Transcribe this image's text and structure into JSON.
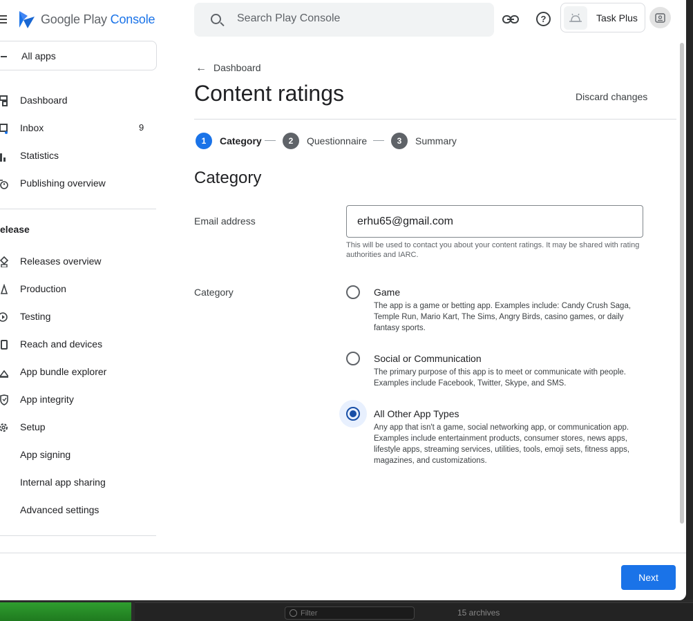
{
  "header": {
    "logo_google": "Google Play ",
    "logo_console": "Console",
    "search_placeholder": "Search Play Console",
    "app_name": "Task Plus"
  },
  "sidebar": {
    "all_apps": "All apps",
    "items_top": [
      {
        "label": "Dashboard",
        "icon": "dashboard-icon"
      },
      {
        "label": "Inbox",
        "icon": "inbox-icon",
        "count": "9"
      },
      {
        "label": "Statistics",
        "icon": "statistics-icon"
      },
      {
        "label": "Publishing overview",
        "icon": "publishing-icon"
      }
    ],
    "section_release": "elease",
    "items_release": [
      {
        "label": "Releases overview",
        "icon": "releases-icon"
      },
      {
        "label": "Production",
        "icon": "production-icon"
      },
      {
        "label": "Testing",
        "icon": "testing-icon"
      },
      {
        "label": "Reach and devices",
        "icon": "devices-icon"
      },
      {
        "label": "App bundle explorer",
        "icon": "bundle-icon"
      },
      {
        "label": "App integrity",
        "icon": "shield-icon"
      },
      {
        "label": "Setup",
        "icon": "gear-icon"
      },
      {
        "label": "App signing"
      },
      {
        "label": "Internal app sharing"
      },
      {
        "label": "Advanced settings"
      }
    ]
  },
  "main": {
    "back_label": "Dashboard",
    "title": "Content ratings",
    "discard": "Discard changes",
    "steps": [
      {
        "num": "1",
        "label": "Category"
      },
      {
        "num": "2",
        "label": "Questionnaire"
      },
      {
        "num": "3",
        "label": "Summary"
      }
    ],
    "section_heading": "Category",
    "email_label": "Email address",
    "email_value": "erhu65@gmail.com",
    "email_help": "This will be used to contact you about your content ratings. It may be shared with rating authorities and IARC.",
    "category_label": "Category",
    "options": [
      {
        "title": "Game",
        "desc": "The app is a game or betting app. Examples include: Candy Crush Saga, Temple Run, Mario Kart, The Sims, Angry Birds, casino games, or daily fantasy sports.",
        "selected": false
      },
      {
        "title": "Social or Communication",
        "desc": "The primary purpose of this app is to meet or communicate with people. Examples include Facebook, Twitter, Skype, and SMS.",
        "selected": false
      },
      {
        "title": "All Other App Types",
        "desc": "Any app that isn't a game, social networking app, or communication app. Examples include entertainment products, consumer stores, news apps, lifestyle apps, streaming services, utilities, tools, emoji sets, fitness apps, magazines, and customizations.",
        "selected": true
      }
    ],
    "next": "Next"
  },
  "background": {
    "filter_placeholder": "Filter",
    "archives": "15 archives"
  },
  "colors": {
    "accent": "#1a73e8",
    "radio_selected": "#174ea6"
  }
}
